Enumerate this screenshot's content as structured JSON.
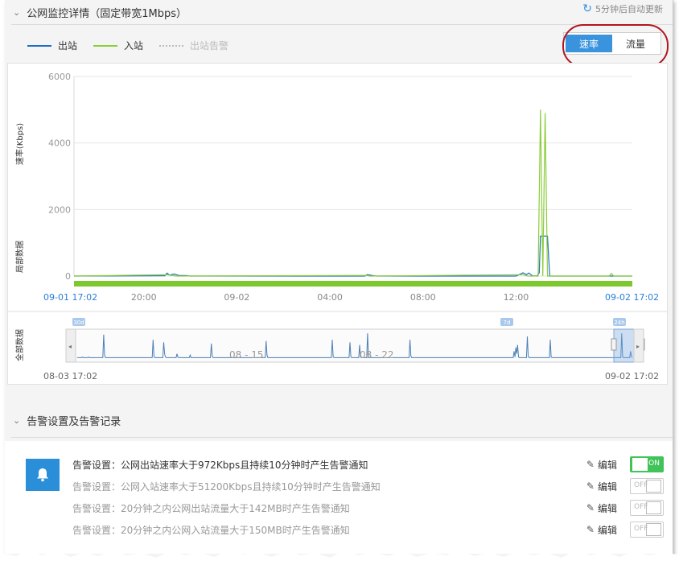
{
  "monitor": {
    "title": "公网监控详情（固定带宽1Mbps）",
    "refresh_text": "5分钟后自动更新",
    "legend": [
      {
        "label": "出站",
        "color": "#1f6fbf"
      },
      {
        "label": "入站",
        "color": "#8ccd3c"
      },
      {
        "label": "出站告警",
        "color": "#bbbbbb"
      }
    ],
    "tabs": [
      {
        "label": "速率",
        "active": true
      },
      {
        "label": "流量",
        "active": false
      }
    ]
  },
  "chart_data": [
    {
      "type": "line",
      "ylabel": "速率(Kbps)",
      "side_label": "局部数据",
      "ylim": [
        0,
        6000
      ],
      "yticks": [
        0,
        2000,
        4000,
        6000
      ],
      "x_tick_labels": [
        "20:00",
        "09-02",
        "04:00",
        "08:00",
        "12:00"
      ],
      "x_start_label": "09-01 17:02",
      "x_end_label": "09-02 17:02",
      "x_range_hours": [
        0,
        24
      ],
      "x_tick_hours": [
        3,
        7,
        11,
        15,
        19
      ],
      "series": [
        {
          "name": "出站",
          "color": "#1f6fbf",
          "points": [
            [
              0,
              0
            ],
            [
              3.9,
              10
            ],
            [
              4.0,
              90
            ],
            [
              4.1,
              30
            ],
            [
              4.3,
              60
            ],
            [
              4.5,
              20
            ],
            [
              4.8,
              15
            ],
            [
              5.0,
              0
            ],
            [
              12.5,
              0
            ],
            [
              12.6,
              40
            ],
            [
              12.8,
              20
            ],
            [
              13.0,
              0
            ],
            [
              19.0,
              0
            ],
            [
              19.3,
              100
            ],
            [
              19.45,
              40
            ],
            [
              19.55,
              90
            ],
            [
              19.7,
              10
            ],
            [
              19.9,
              0
            ],
            [
              20.0,
              100
            ],
            [
              20.05,
              1200
            ],
            [
              20.35,
              1200
            ],
            [
              20.45,
              0
            ],
            [
              24,
              0
            ]
          ]
        },
        {
          "name": "入站",
          "color": "#8ccd3c",
          "points": [
            [
              0,
              0
            ],
            [
              4.0,
              40
            ],
            [
              4.2,
              20
            ],
            [
              4.4,
              0
            ],
            [
              12.6,
              20
            ],
            [
              12.7,
              0
            ],
            [
              19.3,
              40
            ],
            [
              19.5,
              0
            ],
            [
              19.95,
              0
            ],
            [
              20.05,
              5000
            ],
            [
              20.15,
              0
            ],
            [
              20.25,
              4900
            ],
            [
              20.35,
              0
            ],
            [
              24,
              0
            ],
            [
              23.0,
              0
            ],
            [
              23.1,
              80
            ],
            [
              23.2,
              0
            ]
          ]
        }
      ]
    },
    {
      "type": "area",
      "side_label": "全部数据",
      "x_start_label": "08-03 17:02",
      "x_end_label": "09-02 17:02",
      "handle_labels": [
        "30d",
        "7d",
        "24h"
      ],
      "period_labels": [
        "08 - 15",
        "08 - 22"
      ],
      "values": [
        2,
        2,
        2,
        2,
        2,
        2,
        3,
        2,
        2,
        2,
        2,
        2,
        2,
        3,
        2,
        2,
        2,
        2,
        2,
        2,
        2,
        2,
        2,
        2,
        2,
        2,
        2,
        2,
        2,
        2,
        38,
        6,
        2,
        2,
        2,
        2,
        2,
        2,
        2,
        2,
        2,
        2,
        2,
        2,
        2,
        2,
        2,
        2,
        2,
        2,
        2,
        2,
        2,
        2,
        2,
        2,
        2,
        2,
        2,
        2,
        2,
        2,
        2,
        2,
        2,
        2,
        2,
        2,
        2,
        2,
        2,
        2,
        2,
        2,
        2,
        2,
        2,
        2,
        2,
        2,
        2,
        2,
        2,
        2,
        2,
        2,
        30,
        4,
        2,
        2,
        2,
        2,
        2,
        2,
        2,
        2,
        2,
        2,
        26,
        8,
        3,
        2,
        2,
        2,
        2,
        2,
        2,
        2,
        2,
        2,
        2,
        2,
        2,
        8,
        3,
        2,
        2,
        2,
        2,
        2,
        2,
        2,
        2,
        2,
        2,
        2,
        2,
        2,
        6,
        2,
        2,
        2,
        2,
        2,
        2,
        2,
        2,
        2,
        2,
        2,
        2,
        2,
        2,
        2,
        2,
        2,
        2,
        2,
        2,
        2,
        2,
        2,
        24,
        5,
        2,
        2,
        2,
        2,
        2,
        2,
        2,
        2,
        2,
        2,
        2,
        2,
        2,
        2,
        2,
        2,
        2,
        2,
        2,
        2,
        2,
        2,
        2,
        2,
        2,
        2,
        2,
        2,
        2,
        2,
        2,
        2,
        2,
        2,
        2,
        2,
        2,
        2,
        2,
        2,
        2,
        2,
        2,
        2,
        2,
        2,
        2,
        2,
        2,
        2,
        2,
        2,
        2,
        2,
        2,
        2,
        2,
        2,
        2,
        2,
        28,
        6,
        2,
        2,
        2,
        2,
        2,
        2,
        2,
        2,
        2,
        2,
        2,
        2,
        2,
        2,
        2,
        2,
        2,
        2,
        2,
        2,
        2,
        2,
        2,
        2,
        2,
        2,
        2,
        2,
        2,
        2,
        2,
        2,
        2,
        2,
        2,
        2,
        2,
        2,
        2,
        2,
        2,
        2,
        2,
        2,
        2,
        2,
        2,
        2,
        2,
        2,
        2,
        2,
        2,
        2,
        2,
        2,
        2,
        2,
        2,
        2,
        2,
        2,
        2,
        2,
        2,
        2,
        2,
        2,
        2,
        2,
        2,
        2,
        2,
        30,
        4,
        2,
        2,
        2,
        2,
        2,
        2,
        2,
        2,
        2,
        2,
        2,
        2,
        2,
        2,
        2,
        2,
        2,
        2,
        26,
        4,
        2,
        2,
        2,
        2,
        2,
        2,
        2,
        2,
        2,
        22,
        3,
        2,
        2,
        2,
        2,
        2,
        2,
        2,
        40,
        5,
        2,
        2,
        2,
        2,
        2,
        2,
        2,
        2,
        2,
        2,
        2,
        2,
        2,
        2,
        2,
        2,
        2,
        2,
        2,
        2,
        2,
        2,
        2,
        2,
        2,
        2,
        2,
        2,
        2,
        2,
        2,
        2,
        2,
        2,
        2,
        2,
        2,
        2,
        2,
        2,
        2,
        2,
        2,
        2,
        2,
        2,
        30,
        5,
        2,
        2,
        2,
        2,
        2,
        2,
        2,
        2,
        2,
        2,
        2,
        2,
        2,
        2,
        2,
        2,
        2,
        2,
        2,
        2,
        2,
        2,
        2,
        2,
        2,
        2,
        2,
        2,
        2,
        2,
        2,
        2,
        2,
        2,
        2,
        2,
        2,
        2,
        2,
        2,
        2,
        2,
        2,
        2,
        2,
        2,
        2,
        2,
        2,
        2,
        2,
        2,
        2,
        2,
        2,
        2,
        2,
        2,
        2,
        2,
        2,
        2,
        2,
        2,
        2,
        2,
        2,
        2,
        2,
        2,
        2,
        2,
        2,
        2,
        2,
        2,
        2,
        2,
        2,
        2,
        2,
        2,
        2,
        2,
        2,
        2,
        2,
        2,
        2,
        2,
        2,
        2,
        2,
        2,
        2,
        2,
        2,
        2,
        2,
        2,
        2,
        2,
        2,
        2,
        2,
        2,
        2,
        2,
        2,
        2,
        2,
        2,
        2,
        2,
        2,
        2,
        12,
        3,
        18,
        8,
        22,
        3,
        2,
        2,
        2,
        2,
        2,
        2,
        2,
        2,
        2,
        35,
        4,
        2,
        2,
        2,
        2,
        2,
        2,
        2,
        2,
        2,
        2,
        2,
        2,
        2,
        2,
        2,
        2,
        2,
        2,
        2,
        2,
        2,
        2,
        2,
        2,
        30,
        3,
        2,
        2,
        2,
        2,
        2,
        2,
        2,
        2,
        2,
        2,
        2,
        2,
        2,
        2,
        2,
        2,
        2,
        2,
        2,
        2,
        2,
        2,
        2,
        2,
        2,
        2,
        2,
        2,
        2,
        2,
        2,
        2,
        2,
        2,
        2,
        2,
        2,
        2,
        2,
        2,
        2,
        2,
        2,
        2,
        2,
        2,
        2,
        2,
        2,
        2,
        2,
        2,
        2,
        2,
        2,
        2,
        2,
        2,
        2,
        2,
        2,
        2,
        2,
        2,
        2,
        2,
        2,
        2,
        2,
        2,
        2,
        2,
        2,
        2,
        2,
        2,
        2,
        2,
        2,
        40,
        4,
        2,
        2,
        2,
        2,
        2,
        2,
        2,
        2,
        12,
        4,
        2
      ]
    }
  ],
  "alerts": {
    "title": "告警设置及告警记录",
    "rules": [
      {
        "text": "告警设置：公网出站速率大于972Kbps且持续10分钟时产生告警通知",
        "edit": "编辑",
        "state": "ON",
        "on": true
      },
      {
        "text": "告警设置：公网入站速率大于51200Kbps且持续10分钟时产生告警通知",
        "edit": "编辑",
        "state": "OFF",
        "on": false
      },
      {
        "text": "告警设置：20分钟之内公网出站流量大于142MB时产生告警通知",
        "edit": "编辑",
        "state": "OFF",
        "on": false
      },
      {
        "text": "告警设置：20分钟之内公网入站流量大于150MB时产生告警通知",
        "edit": "编辑",
        "state": "OFF",
        "on": false
      }
    ]
  }
}
